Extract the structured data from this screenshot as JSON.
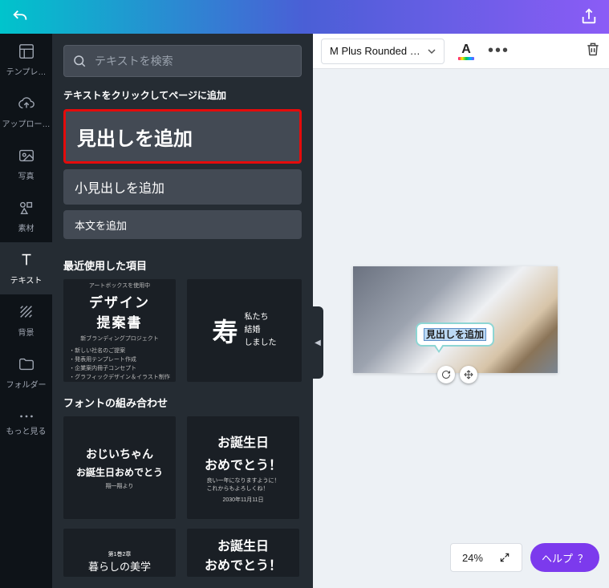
{
  "topbar": {},
  "rail": {
    "template": "テンプレ…",
    "upload": "アップロー…",
    "photo": "写真",
    "elements": "素材",
    "text": "テキスト",
    "background": "背景",
    "folder": "フォルダー",
    "more": "もっと見る"
  },
  "panel": {
    "search_placeholder": "テキストを検索",
    "hint": "テキストをクリックしてページに追加",
    "add_heading": "見出しを追加",
    "add_subheading": "小見出しを追加",
    "add_body": "本文を追加",
    "recent_title": "最近使用した項目",
    "recent1_sup": "アートボックスを使用中",
    "recent1_big1": "デザイン",
    "recent1_big2": "提案書",
    "recent1_sub": "新ブランディングプロジェクト",
    "recent1_bullets": "・新しい社名のご提案\n・発表用テンプレート作成\n・企業案内冊子コンセプト\n・グラフィックデザイン＆イラスト制作",
    "recent2_kanji": "寿",
    "recent2_side": "私たち\n結婚\nしました",
    "font_combo_title": "フォントの組み合わせ",
    "combo1_l1": "おじいちゃん",
    "combo1_l2": "お誕生日おめでとう",
    "combo1_l3": "翔一翔より",
    "combo2_l1": "お誕生日",
    "combo2_l2": "おめでとう！",
    "combo2_l3": "良い一年になりますように！\nこれからもよろしくね！",
    "combo2_l4": "2030年11月11日",
    "combo3_l1": "第1巻2章",
    "combo3_l2": "暮らしの美学",
    "combo4_l1": "お誕生日",
    "combo4_l2": "おめでとう！"
  },
  "toolbar": {
    "font": "M Plus Rounded …",
    "color_letter": "A"
  },
  "canvas": {
    "bubble_text": "見出しを追加"
  },
  "bottom": {
    "zoom": "24%",
    "help": "ヘルプ",
    "help_q": "？"
  }
}
